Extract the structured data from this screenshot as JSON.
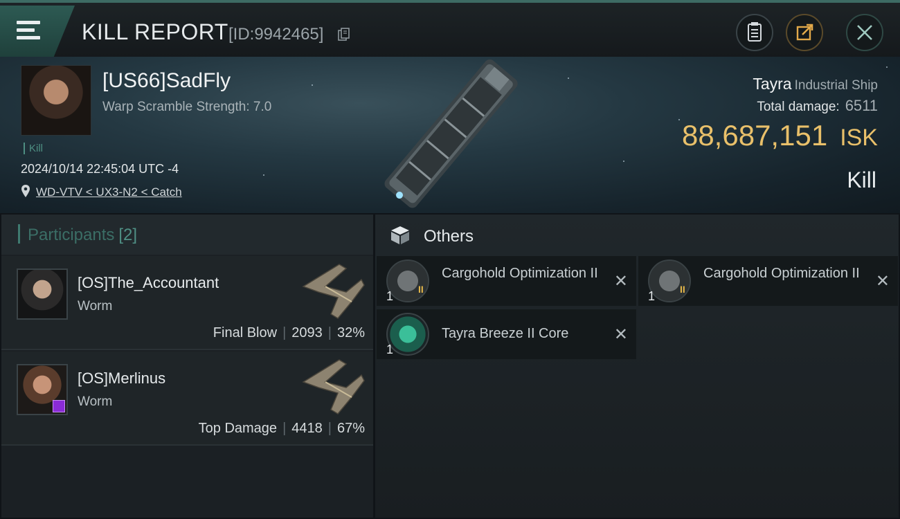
{
  "header": {
    "title": "KILL REPORT",
    "report_id": "[ID:9942465]"
  },
  "victim": {
    "name": "[US66]SadFly",
    "warp_scramble": "Warp Scramble Strength: 7.0",
    "tag": "Kill",
    "datetime": "2024/10/14 22:45:04 UTC -4",
    "location": "WD-VTV < UX3-N2 < Catch"
  },
  "ship": {
    "name": "Tayra",
    "class": "Industrial Ship",
    "total_damage_label": "Total damage:",
    "total_damage": "6511",
    "isk_value": "88,687,151",
    "isk_unit": "ISK",
    "kill_type": "Kill"
  },
  "participants": {
    "title": "Participants",
    "count": "[2]",
    "items": [
      {
        "name": "[OS]The_Accountant",
        "ship": "Worm",
        "role": "Final Blow",
        "damage": "2093",
        "percent": "32%"
      },
      {
        "name": "[OS]Merlinus",
        "ship": "Worm",
        "role": "Top Damage",
        "damage": "4418",
        "percent": "67%"
      }
    ]
  },
  "others": {
    "title": "Others",
    "items": [
      {
        "name": "Cargohold Optimization II",
        "qty": "1",
        "tier": "II"
      },
      {
        "name": "Cargohold Optimization II",
        "qty": "1",
        "tier": "II"
      },
      {
        "name": "Tayra Breeze II Core",
        "qty": "1",
        "tier": ""
      }
    ]
  },
  "colors": {
    "accent": "#3f7a70",
    "isk": "#e9c06a",
    "badge": "#8a2bd6"
  },
  "icons": {
    "menu": "menu-icon",
    "copy": "copy-icon",
    "clipboard": "clipboard-icon",
    "share": "share-icon",
    "close": "close-icon",
    "pin": "location-pin-icon",
    "cube": "cube-icon",
    "remove": "x-icon"
  }
}
